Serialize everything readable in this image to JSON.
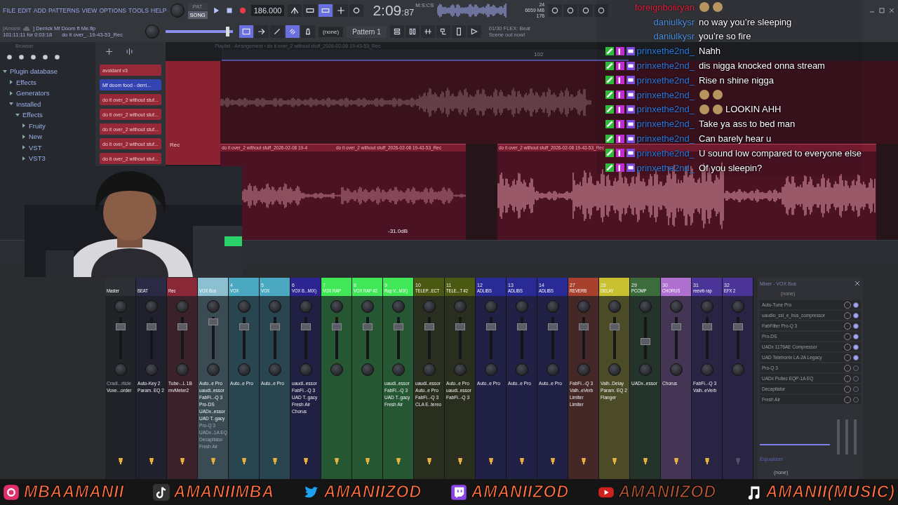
{
  "menu": [
    "FILE",
    "EDIT",
    "ADD",
    "PATTERNS",
    "VIEW",
    "OPTIONS",
    "TOOLS",
    "HELP"
  ],
  "transport": {
    "modes": [
      {
        "label": "PAT",
        "selected": false
      },
      {
        "label": "SONG",
        "selected": true
      }
    ],
    "recording": true,
    "tempo": "186.000",
    "master_slider": {
      "level": 0.95
    }
  },
  "clock": {
    "time": "2:09",
    "centis": ":87",
    "unit": "M:S:CS"
  },
  "stats": {
    "cpu": "24",
    "memory": "6659 MB",
    "polyphony": "176"
  },
  "hint": {
    "owner": "[Amanii",
    "file": "] Derrick Mf Doom ft Me.flp",
    "position": "101:11:11 for 0:03:18",
    "clip": "do it over_..19-43-53_Rec"
  },
  "pattern_picker": {
    "channel": "(none)",
    "pattern": "Pattern 1"
  },
  "news": "01/30  FLEX: Beat Scene out now!",
  "browser": {
    "title": "Browser",
    "tree": [
      {
        "label": "Plugin database",
        "expanded": true,
        "children": [
          {
            "label": "Effects",
            "expanded": false
          },
          {
            "label": "Generators",
            "expanded": false
          },
          {
            "label": "Installed",
            "expanded": true,
            "children": [
              {
                "label": "Effects",
                "expanded": true,
                "children": [
                  {
                    "label": "Fruity",
                    "expanded": false
                  },
                  {
                    "label": "New",
                    "expanded": false
                  },
                  {
                    "label": "VST",
                    "expanded": false
                  },
                  {
                    "label": "VST3",
                    "expanded": false
                  }
                ]
              }
            ]
          }
        ]
      }
    ]
  },
  "channel_rack": {
    "patterns": [
      {
        "name": "avoidant v3",
        "selected": false
      },
      {
        "name": "Mf doom food - derri...",
        "selected": true
      },
      {
        "name": "do it over_2 without stuf...",
        "selected": false
      },
      {
        "name": "do it over_2 without stuf...",
        "selected": false
      },
      {
        "name": "do it over_2 without stuf...",
        "selected": false
      },
      {
        "name": "do it over_2 without stuf...",
        "selected": false
      },
      {
        "name": "do it over_2 without stuf...",
        "selected": false
      }
    ]
  },
  "playlist": {
    "title": "Playlist - Arrangement › do it over_2 without stuff_2026-02-08 19-43-53_Rec",
    "ruler": "102",
    "track": "Rec",
    "clips": [
      "do it over_2 without stuff_2026-02-08 19-4",
      "do it over_2 without stuff_2026-02-08 19-43-53_Rec",
      "do it over_2 without stuff_2026-02-08 19-43-53_Rec"
    ],
    "gain": "-31.0dB"
  },
  "chat": [
    {
      "user": "foreignboiiryan",
      "color": "#e0203a",
      "badged": false,
      "kind": "emote"
    },
    {
      "user": "daniulkysr",
      "color": "#4a90e0",
      "badged": false,
      "kind": "text",
      "text": "no way you’re sleeping"
    },
    {
      "user": "daniulkysr",
      "color": "#4a90e0",
      "badged": false,
      "kind": "text",
      "text": "you’re so fire"
    },
    {
      "user": "prinxethe2nd_",
      "color": "#2a7ae0",
      "badged": true,
      "kind": "text",
      "text": "Nahh"
    },
    {
      "user": "prinxethe2nd_",
      "color": "#2a7ae0",
      "badged": true,
      "kind": "text",
      "text": "dis nigga knocked onna stream"
    },
    {
      "user": "prinxethe2nd_",
      "color": "#2a7ae0",
      "badged": true,
      "kind": "text",
      "text": "Rise n shine nigga"
    },
    {
      "user": "prinxethe2nd_",
      "color": "#2a7ae0",
      "badged": true,
      "kind": "emote"
    },
    {
      "user": "prinxethe2nd_",
      "color": "#2a7ae0",
      "badged": true,
      "kind": "emote",
      "text": "LOOKIN AHH"
    },
    {
      "user": "prinxethe2nd_",
      "color": "#2a7ae0",
      "badged": true,
      "kind": "text",
      "text": "Take ya ass to bed man"
    },
    {
      "user": "prinxethe2nd_",
      "color": "#2a7ae0",
      "badged": true,
      "kind": "text",
      "text": "Can barely hear u"
    },
    {
      "user": "prinxethe2nd_",
      "color": "#2a7ae0",
      "badged": true,
      "kind": "text",
      "text": "U sound low compared to everyone else"
    },
    {
      "user": "prinxethe2nd_",
      "color": "#2a7ae0",
      "badged": true,
      "kind": "text",
      "text": "Of you sleepin?"
    }
  ],
  "mixer": {
    "tracks": [
      {
        "name": "Master",
        "color": "#2c2f33",
        "level": 0.8,
        "routed": true,
        "plugins": [
          {
            "name": "Cradl...rticle",
            "disabled": true
          },
          {
            "name": "Voxe...order",
            "disabled": false
          }
        ]
      },
      {
        "name": "BEAT",
        "color": "#2a2a44",
        "level": 0.8,
        "routed": true,
        "plugins": [
          {
            "name": "Auto-Key 2",
            "disabled": false
          },
          {
            "name": "Param. EQ 2",
            "disabled": false
          }
        ]
      },
      {
        "name": "Rec",
        "color": "#8a2838",
        "level": 0.8,
        "routed": true,
        "plugins": [
          {
            "name": "Tube-..L 1B",
            "disabled": false
          },
          {
            "name": "mvMeter2",
            "disabled": false
          }
        ]
      },
      {
        "name": "VOX Bus",
        "color": "#8cc0d0",
        "level": 0.92,
        "routed": true,
        "plugins": [
          {
            "name": "Auto..e Pro",
            "disabled": false
          },
          {
            "name": "uaudi..essor",
            "disabled": false
          },
          {
            "name": "FabFi..-Q 3",
            "disabled": false
          },
          {
            "name": "Pro-DS",
            "disabled": false
          },
          {
            "name": "UADx..essor",
            "disabled": false
          },
          {
            "name": "UAD T..gacy",
            "disabled": false
          },
          {
            "name": "Pro-Q 3",
            "disabled": true
          },
          {
            "name": "UADx..1A EQ",
            "disabled": true
          },
          {
            "name": "Decapitator",
            "disabled": true
          },
          {
            "name": "Fresh Air",
            "disabled": true
          }
        ]
      },
      {
        "number": "4",
        "name": "VOX",
        "color": "#4aa8c0",
        "level": 0.8,
        "routed": true,
        "plugins": [
          {
            "name": "Auto..e Pro",
            "disabled": false
          }
        ]
      },
      {
        "number": "5",
        "name": "VOX",
        "color": "#4aa8c0",
        "level": 0.8,
        "routed": true,
        "plugins": [
          {
            "name": "Auto..e Pro",
            "disabled": false
          }
        ]
      },
      {
        "number": "6",
        "name": "VOX B...MIX)",
        "color": "#2c2490",
        "level": 0.8,
        "routed": true,
        "plugins": [
          {
            "name": "uaudi..essor",
            "disabled": false
          },
          {
            "name": "FabFi..-Q 3",
            "disabled": false
          },
          {
            "name": "UAD T..gacy",
            "disabled": false
          },
          {
            "name": "Fresh Air",
            "disabled": false
          },
          {
            "name": "Chorus",
            "disabled": false
          }
        ]
      },
      {
        "number": "7",
        "name": "VOX RAP",
        "color": "#40e858",
        "level": 0.8,
        "routed": true
      },
      {
        "number": "8",
        "name": "VOX RAP #2",
        "color": "#40e858",
        "level": 0.8,
        "routed": true
      },
      {
        "number": "9",
        "name": "Rap V...MIX)",
        "color": "#40e858",
        "level": 0.8,
        "routed": true,
        "plugins": [
          {
            "name": "uaudi..essor",
            "disabled": false
          },
          {
            "name": "FabFi..-Q 3",
            "disabled": false
          },
          {
            "name": "UAD T..gacy",
            "disabled": false
          },
          {
            "name": "Fresh Air",
            "disabled": false
          }
        ]
      },
      {
        "number": "10",
        "name": "TELEP...ECT",
        "color": "#4a5812",
        "level": 0.8,
        "routed": true,
        "plugins": [
          {
            "name": "uaudi..essor",
            "disabled": false
          },
          {
            "name": "Auto..e Pro",
            "disabled": false
          },
          {
            "name": "FabFi..-Q 3",
            "disabled": false
          },
          {
            "name": "CLA E..tereo",
            "disabled": false
          }
        ]
      },
      {
        "number": "11",
        "name": "TELE...T #2",
        "color": "#4a5812",
        "level": 0.8,
        "routed": true,
        "plugins": [
          {
            "name": "Auto..e Pro",
            "disabled": false
          },
          {
            "name": "uaudi..essor",
            "disabled": false
          },
          {
            "name": "FabFi..-Q 3",
            "disabled": false
          }
        ]
      },
      {
        "number": "12",
        "name": "ADLIBS",
        "color": "#2a2a96",
        "level": 0.8,
        "routed": true,
        "plugins": [
          {
            "name": "Auto..e Pro",
            "disabled": false
          }
        ]
      },
      {
        "number": "13",
        "name": "ADLIBS",
        "color": "#2a2a96",
        "level": 0.8,
        "routed": true,
        "plugins": [
          {
            "name": "Auto..e Pro",
            "disabled": false
          }
        ]
      },
      {
        "number": "14",
        "name": "ADLIBS",
        "color": "#2a2a96",
        "level": 0.8,
        "routed": true,
        "plugins": [
          {
            "name": "Auto..e Pro",
            "disabled": false
          }
        ]
      },
      {
        "number": "27",
        "name": "REVERB",
        "color": "#a8402e",
        "level": 0.8,
        "routed": true,
        "plugins": [
          {
            "name": "FabFi..-Q 3",
            "disabled": false
          },
          {
            "name": "Valh..eVerb",
            "disabled": false
          },
          {
            "name": "Limiter",
            "disabled": false
          },
          {
            "name": "Limiter",
            "disabled": false
          }
        ]
      },
      {
        "number": "28",
        "name": "DELAY",
        "color": "#c8c030",
        "level": 0.8,
        "routed": true,
        "plugins": [
          {
            "name": "Valh..Delay",
            "disabled": false
          },
          {
            "name": "Param. EQ 2",
            "disabled": false
          },
          {
            "name": "Flanger",
            "disabled": false
          }
        ]
      },
      {
        "number": "29",
        "name": "PCOMP",
        "color": "#3c6c3c",
        "level": 0.45,
        "routed": true,
        "plugins": [
          {
            "name": "UADx..essor",
            "disabled": false
          }
        ]
      },
      {
        "number": "30",
        "name": "CHORUS",
        "color": "#b070d0",
        "level": 0.8,
        "routed": true,
        "plugins": [
          {
            "name": "Chorus",
            "disabled": false
          }
        ]
      },
      {
        "number": "31",
        "name": "reevrb rap",
        "color": "#4a3498",
        "level": 0.8,
        "routed": true,
        "plugins": [
          {
            "name": "FabFi..-Q 3",
            "disabled": false
          },
          {
            "name": "Valh..eVerb",
            "disabled": false
          }
        ]
      },
      {
        "number": "32",
        "name": "EFX 2",
        "color": "#4a3498",
        "level": 0.8,
        "routed": false
      }
    ],
    "panel": {
      "title": "Mixer - VOX Bus",
      "input": "(none)",
      "slots": [
        {
          "name": "Auto-Tune Pro",
          "enabled": true
        },
        {
          "name": "uaudio_ssl_e_bus_compressor",
          "enabled": true
        },
        {
          "name": "FabFilter Pro-Q 3",
          "enabled": true
        },
        {
          "name": "Pro-DS",
          "enabled": true
        },
        {
          "name": "UADx 1176AE Compressor",
          "enabled": true
        },
        {
          "name": "UAD Teletronix LA-2A Legacy",
          "enabled": true
        },
        {
          "name": "Pro-Q 3",
          "enabled": false
        },
        {
          "name": "UADx Pultec EQP-1A EQ",
          "enabled": false
        },
        {
          "name": "Decapitator",
          "enabled": false
        },
        {
          "name": "Fresh Air",
          "enabled": false
        }
      ],
      "eq": "Equalizer",
      "output": "(none)"
    }
  },
  "socials": [
    {
      "kind": "instagram",
      "handle": "MBAAMANII"
    },
    {
      "kind": "tiktok",
      "handle": "AMANIIMBA"
    },
    {
      "kind": "twitter",
      "handle": "AMANIIZOD"
    },
    {
      "kind": "twitch",
      "handle": "AMANIIZOD"
    },
    {
      "kind": "youtube",
      "handle": "AMANIIZOD"
    },
    {
      "kind": "music",
      "handle": "AMANII(MUSIC)"
    }
  ]
}
